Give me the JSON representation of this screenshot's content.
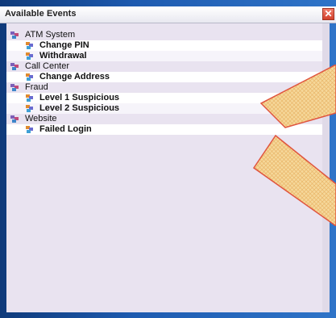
{
  "window": {
    "title": "Available Events",
    "close_glyph": "✕"
  },
  "tree": [
    {
      "label": "ATM System",
      "icon": "group-icon",
      "events": [
        {
          "label": "Change PIN",
          "icon": "event-icon"
        },
        {
          "label": "Withdrawal",
          "icon": "event-icon"
        }
      ]
    },
    {
      "label": "Call Center",
      "icon": "group-icon",
      "events": [
        {
          "label": "Change Address",
          "icon": "event-icon"
        }
      ]
    },
    {
      "label": "Fraud",
      "icon": "group-icon",
      "events": [
        {
          "label": "Level 1 Suspicious",
          "icon": "event-icon"
        },
        {
          "label": "Level 2 Suspicious",
          "icon": "event-icon"
        }
      ]
    },
    {
      "label": "Website",
      "icon": "group-icon",
      "events": [
        {
          "label": "Failed Login",
          "icon": "event-icon"
        }
      ]
    }
  ],
  "colors": {
    "callout_fill": "#f6d89a",
    "callout_stroke": "#e0553f",
    "background_left": "#0f3a7a",
    "background_right": "#2f74c8"
  }
}
